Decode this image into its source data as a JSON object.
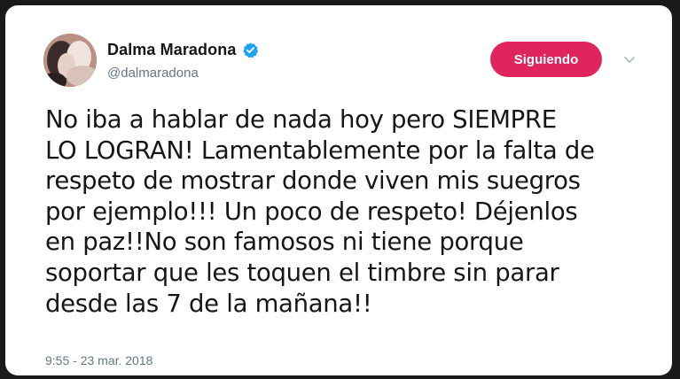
{
  "tweet": {
    "author": {
      "display_name": "Dalma Maradona",
      "handle": "@dalmaradona",
      "verified": true,
      "avatar_icon": "profile-photo"
    },
    "follow_button": {
      "label": "Siguiendo",
      "color": "#e0245e"
    },
    "menu_icon": "chevron-down-icon",
    "text_lines": [
      "No iba a hablar de nada hoy pero SIEMPRE",
      "LO LOGRAN! Lamentablemente por la falta de",
      "respeto de mostrar donde viven mis suegros",
      "por ejemplo!!! Un poco de respeto! Déjenlos",
      "en paz!!No son famosos ni tiene porque",
      "soportar que les toquen el timbre sin parar",
      "desde las 7 de la mañana!!"
    ],
    "timestamp": "9:55 - 23 mar. 2018"
  },
  "colors": {
    "verified_badge": "#1da1f2",
    "text_primary": "#14171a",
    "text_secondary": "#657786"
  }
}
